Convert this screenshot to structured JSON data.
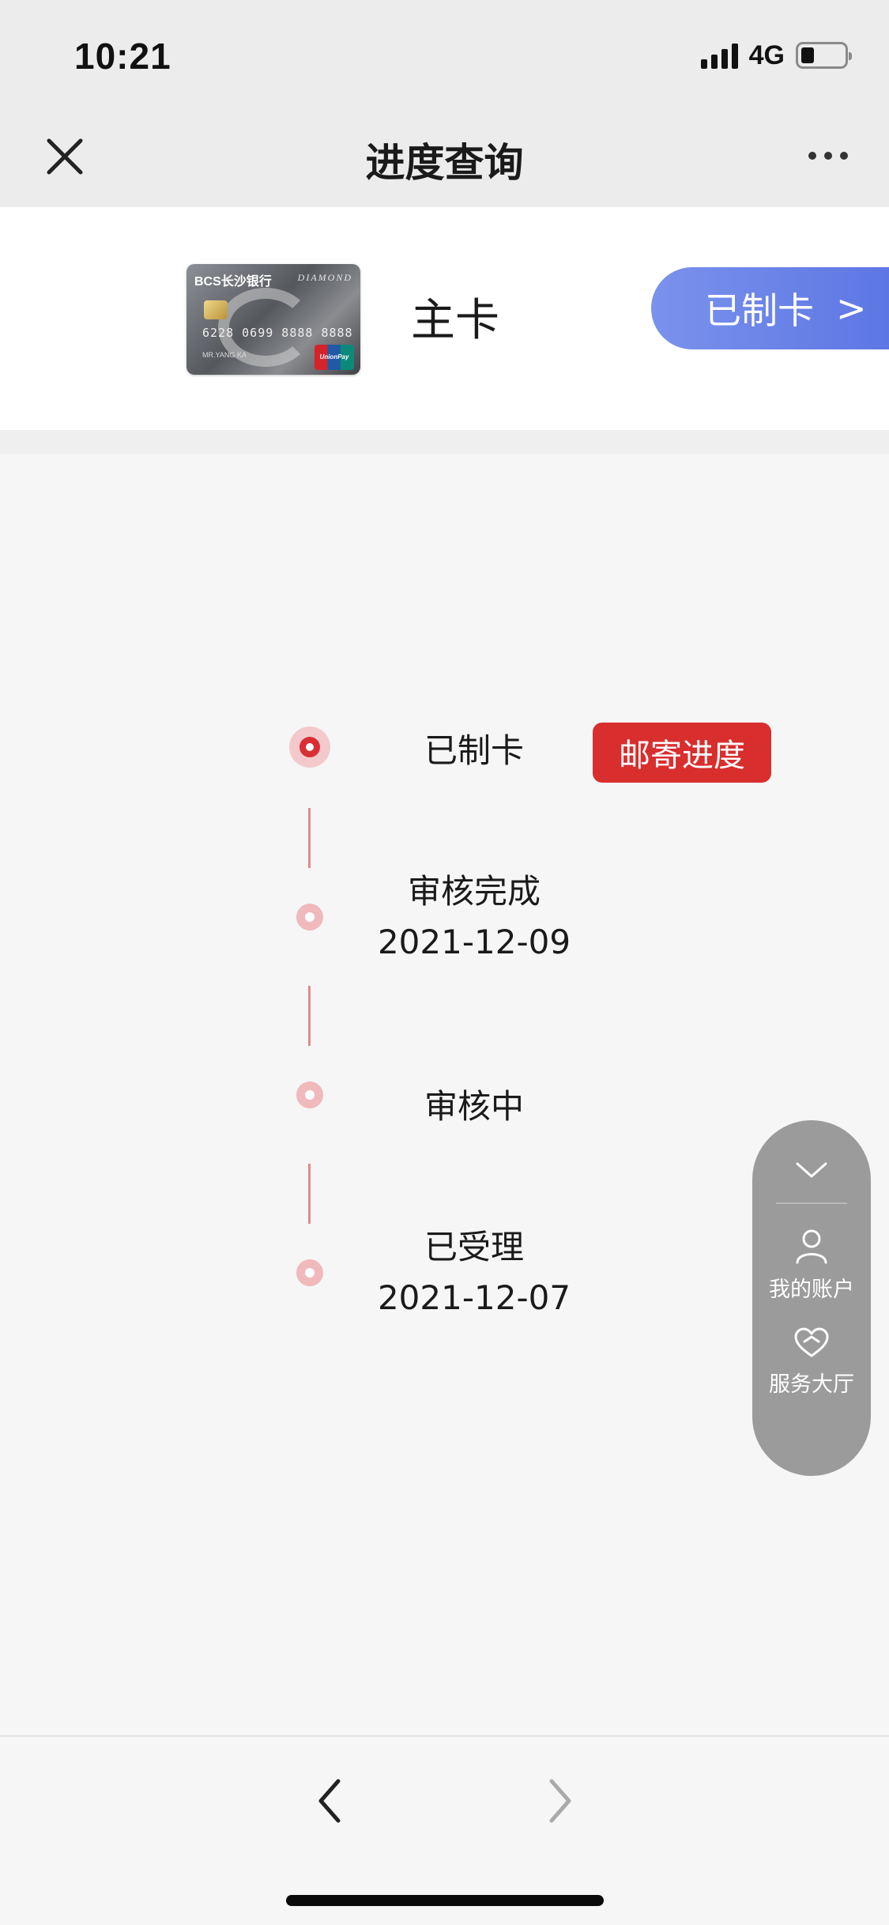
{
  "status_bar": {
    "time": "10:21",
    "network": "4G",
    "battery_level": 0.3
  },
  "nav": {
    "title": "进度查询"
  },
  "card": {
    "bank_name": "BCS长沙银行",
    "card_tier": "DIAMOND",
    "card_number": "6228 0699 8888 8888",
    "holder": "MR.YANG KA",
    "network_logo": "UnionPay",
    "label": "主卡",
    "status_button": "已制卡",
    "status_chevron": ">"
  },
  "timeline": {
    "mail_button": "邮寄进度",
    "steps": [
      {
        "title": "已制卡",
        "date": "",
        "active": true
      },
      {
        "title": "审核完成",
        "date": "2021-12-09",
        "active": false
      },
      {
        "title": "审核中",
        "date": "",
        "active": false
      },
      {
        "title": "已受理",
        "date": "2021-12-07",
        "active": false
      }
    ]
  },
  "float_panel": {
    "items": [
      {
        "label": "我的账户",
        "icon": "person-icon"
      },
      {
        "label": "服务大厅",
        "icon": "heart-icon"
      }
    ]
  },
  "colors": {
    "accent_red": "#d92e2e",
    "pill_blue": "#5a74e3",
    "timeline_pink": "#f0b9bc"
  }
}
